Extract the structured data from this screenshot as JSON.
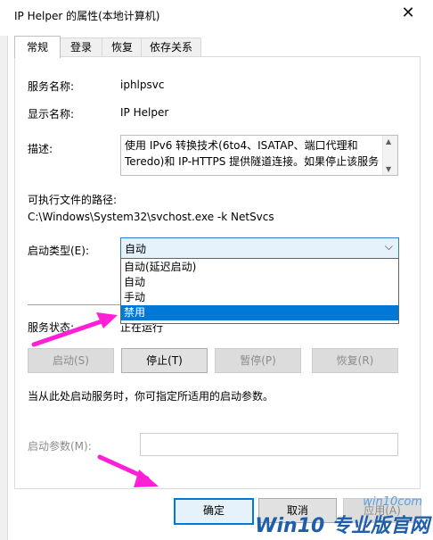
{
  "window": {
    "title": "IP Helper 的属性(本地计算机)",
    "close_glyph": "✕"
  },
  "tabs": [
    {
      "label": "常规"
    },
    {
      "label": "登录"
    },
    {
      "label": "恢复"
    },
    {
      "label": "依存关系"
    }
  ],
  "general": {
    "service_name_label": "服务名称:",
    "service_name_value": "iphlpsvc",
    "display_name_label": "显示名称:",
    "display_name_value": "IP Helper",
    "description_label": "描述:",
    "description_text": "使用 IPv6 转换技术(6to4、ISATAP、端口代理和\nTeredo)和 IP-HTTPS 提供隧道连接。如果停止该服务",
    "path_label": "可执行文件的路径:",
    "path_value": "C:\\Windows\\System32\\svchost.exe -k NetSvcs",
    "startup_type_label": "启动类型(E):",
    "startup_type_selected": "自动",
    "startup_options": [
      "自动(延迟启动)",
      "自动",
      "手动",
      "禁用"
    ],
    "highlighted_option": "禁用",
    "status_label": "服务状态:",
    "status_value": "正在运行",
    "buttons": {
      "start": "启动(S)",
      "stop": "停止(T)",
      "pause": "暂停(P)",
      "resume": "恢复(R)"
    },
    "hint_text": "当从此处启动服务时，你可指定所适用的启动参数。",
    "param_label": "启动参数(M):",
    "param_value": ""
  },
  "footer": {
    "ok": "确定",
    "cancel": "取消",
    "apply": "应用(A)"
  },
  "watermark": {
    "logo": "Win10 专业版官网",
    "url": "win10com"
  },
  "colors": {
    "accent": "#0078d7",
    "arrow": "#ff1fd6",
    "selection_bg": "#0078d7"
  },
  "icons": {
    "close": "close-icon",
    "dropdown": "chevron-down-icon"
  }
}
